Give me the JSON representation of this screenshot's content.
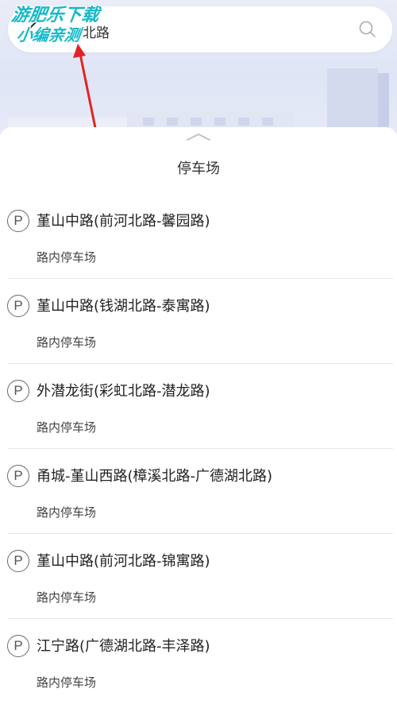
{
  "search": {
    "query": "北路"
  },
  "watermark": {
    "line1": "游肥乐下载",
    "line2": "小编亲测"
  },
  "panel": {
    "title": "停车场",
    "items": [
      {
        "icon": "P",
        "name": "堇山中路(前河北路-馨园路)",
        "type": "路内停车场"
      },
      {
        "icon": "P",
        "name": "堇山中路(钱湖北路-泰寓路)",
        "type": "路内停车场"
      },
      {
        "icon": "P",
        "name": "外潜龙街(彩虹北路-潜龙路)",
        "type": "路内停车场"
      },
      {
        "icon": "P",
        "name": "甬城-堇山西路(樟溪北路-广德湖北路)",
        "type": "路内停车场"
      },
      {
        "icon": "P",
        "name": "堇山中路(前河北路-锦寓路)",
        "type": "路内停车场"
      },
      {
        "icon": "P",
        "name": "江宁路(广德湖北路-丰泽路)",
        "type": "路内停车场"
      }
    ]
  },
  "colors": {
    "watermark": "#14b9c9",
    "arrow": "#e02424",
    "background_top": "#e2e7f5"
  }
}
